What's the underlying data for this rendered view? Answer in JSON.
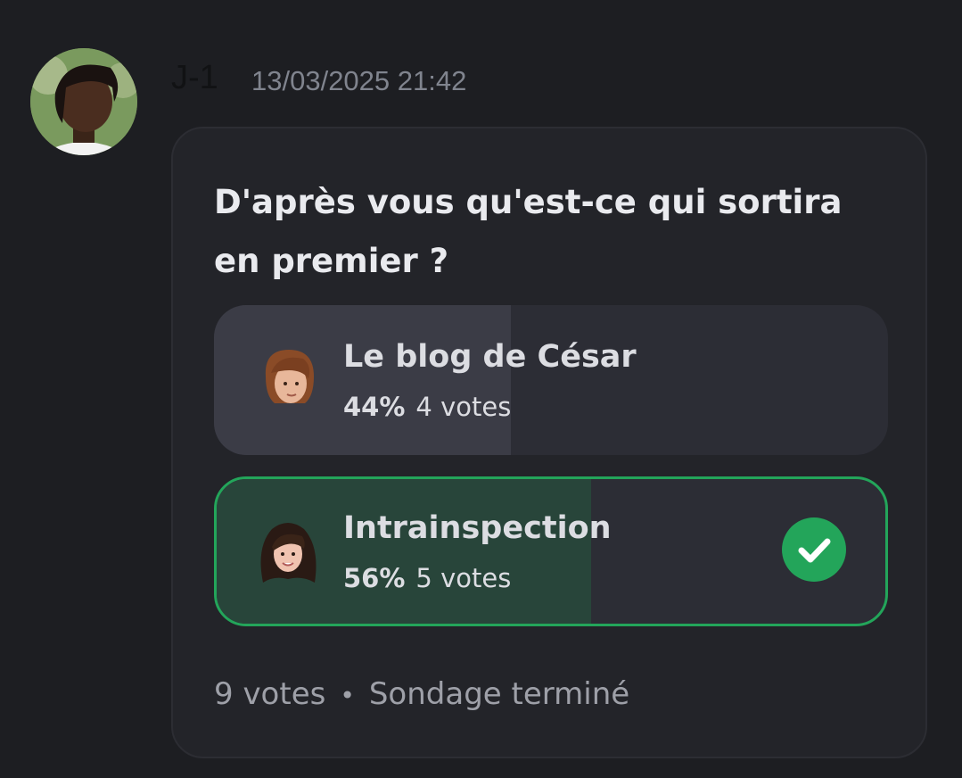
{
  "message": {
    "author": "J-1",
    "timestamp": "13/03/2025 21:42"
  },
  "poll": {
    "question": "D'après vous qu'est-ce qui sortira en premier ?",
    "options": [
      {
        "label": "Le blog de César",
        "percent_text": "44%",
        "votes_text": "4 votes",
        "fraction": 0.44,
        "winner": false
      },
      {
        "label": "Intrainspection",
        "percent_text": "56%",
        "votes_text": "5 votes",
        "fraction": 0.56,
        "winner": true
      }
    ],
    "total_votes": "9 votes",
    "separator": "•",
    "status": "Sondage terminé"
  },
  "colors": {
    "winner_accent": "#23a55a",
    "winner_fill": "#28453a",
    "option_fill": "#3b3c46"
  },
  "icons": {
    "winner_check": "check-circle-icon"
  }
}
